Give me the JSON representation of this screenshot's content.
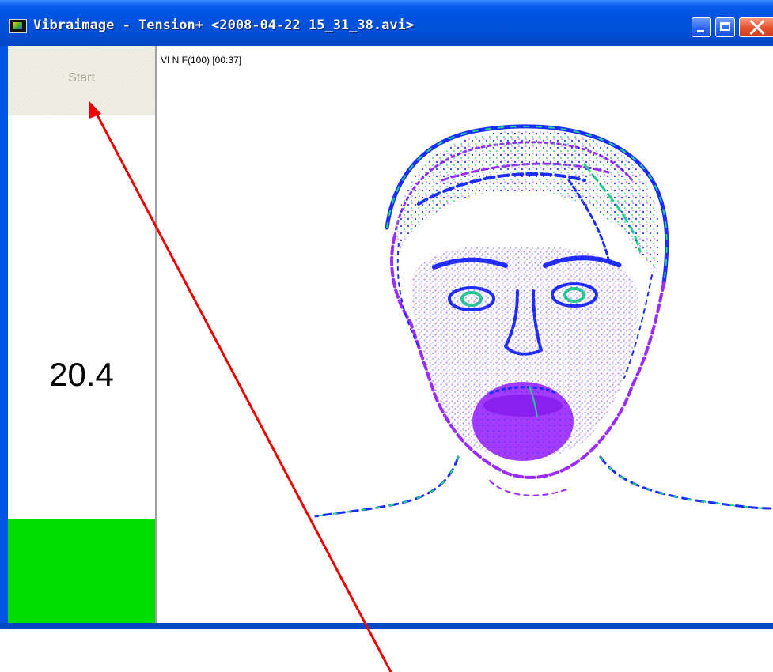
{
  "window": {
    "title": "Vibraimage - Tension+ <2008-04-22 15_31_38.avi>"
  },
  "controls": {
    "start_label": "Start"
  },
  "readout": {
    "tension_value": "20.4",
    "indicator_color": "#00dd00"
  },
  "video": {
    "overlay": "VI N F(100) [00:37]"
  },
  "annotation": {
    "color": "#ee0000"
  },
  "colors": {
    "titlebar": "#0054e3",
    "close_button": "#e5502a",
    "vibra_purple": "#9b2cff",
    "vibra_blue": "#1a2cff",
    "vibra_green": "#1fd28a"
  }
}
